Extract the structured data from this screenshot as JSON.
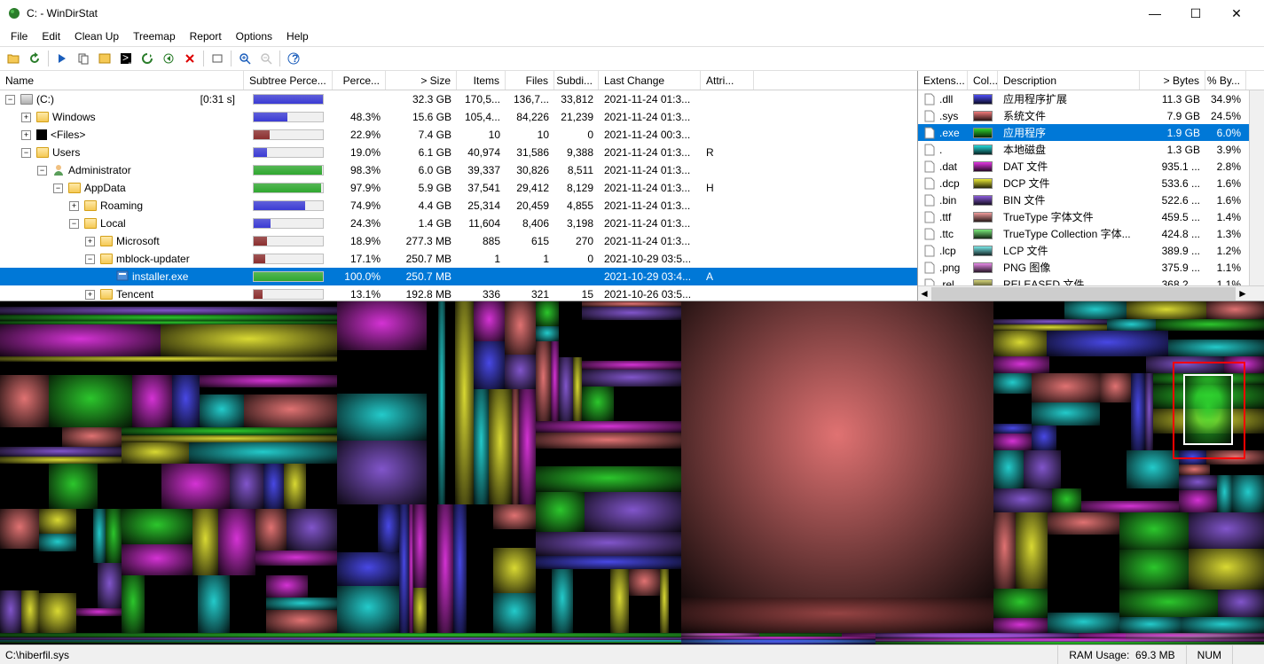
{
  "window": {
    "title": "C: - WinDirStat",
    "controls": {
      "min": "—",
      "max": "☐",
      "close": "✕"
    }
  },
  "menu": [
    "File",
    "Edit",
    "Clean Up",
    "Treemap",
    "Report",
    "Options",
    "Help"
  ],
  "tree": {
    "headers": [
      "Name",
      "Subtree Perce...",
      "Perce...",
      "> Size",
      "Items",
      "Files",
      "Subdi...",
      "Last Change",
      "Attri..."
    ],
    "widths": [
      275,
      100,
      60,
      80,
      55,
      55,
      50,
      115,
      60
    ],
    "rows": [
      {
        "indent": 0,
        "toggle": "-",
        "icon": "drive",
        "name": "(C:)",
        "suffix": "[0:31 s]",
        "bar": 100,
        "barColor": "#3b3bd4",
        "perc": "",
        "size": "32.3 GB",
        "items": "170,5...",
        "files": "136,7...",
        "subdir": "33,812",
        "date": "2021-11-24  01:3...",
        "attr": ""
      },
      {
        "indent": 1,
        "toggle": "+",
        "icon": "folder",
        "name": "Windows",
        "bar": 48.3,
        "barColor": "#3b3bd4",
        "perc": "48.3%",
        "size": "15.6 GB",
        "items": "105,4...",
        "files": "84,226",
        "subdir": "21,239",
        "date": "2021-11-24  01:3...",
        "attr": ""
      },
      {
        "indent": 1,
        "toggle": "+",
        "icon": "files",
        "name": "<Files>",
        "bar": 22.9,
        "barColor": "#8b2e2e",
        "perc": "22.9%",
        "size": "7.4 GB",
        "items": "10",
        "files": "10",
        "subdir": "0",
        "date": "2021-11-24  00:3...",
        "attr": ""
      },
      {
        "indent": 1,
        "toggle": "-",
        "icon": "folder",
        "name": "Users",
        "bar": 19.0,
        "barColor": "#3b3bd4",
        "perc": "19.0%",
        "size": "6.1 GB",
        "items": "40,974",
        "files": "31,586",
        "subdir": "9,388",
        "date": "2021-11-24  01:3...",
        "attr": "R"
      },
      {
        "indent": 2,
        "toggle": "-",
        "icon": "user",
        "name": "Administrator",
        "bar": 98.3,
        "barColor": "#2fa82f",
        "perc": "98.3%",
        "size": "6.0 GB",
        "items": "39,337",
        "files": "30,826",
        "subdir": "8,511",
        "date": "2021-11-24  01:3...",
        "attr": ""
      },
      {
        "indent": 3,
        "toggle": "-",
        "icon": "folder",
        "name": "AppData",
        "bar": 97.9,
        "barColor": "#2fa82f",
        "perc": "97.9%",
        "size": "5.9 GB",
        "items": "37,541",
        "files": "29,412",
        "subdir": "8,129",
        "date": "2021-11-24  01:3...",
        "attr": "H"
      },
      {
        "indent": 4,
        "toggle": "+",
        "icon": "folder",
        "name": "Roaming",
        "bar": 74.9,
        "barColor": "#3b3bd4",
        "perc": "74.9%",
        "size": "4.4 GB",
        "items": "25,314",
        "files": "20,459",
        "subdir": "4,855",
        "date": "2021-11-24  01:3...",
        "attr": ""
      },
      {
        "indent": 4,
        "toggle": "-",
        "icon": "folder",
        "name": "Local",
        "bar": 24.3,
        "barColor": "#3b3bd4",
        "perc": "24.3%",
        "size": "1.4 GB",
        "items": "11,604",
        "files": "8,406",
        "subdir": "3,198",
        "date": "2021-11-24  01:3...",
        "attr": ""
      },
      {
        "indent": 5,
        "toggle": "+",
        "icon": "folder",
        "name": "Microsoft",
        "bar": 18.9,
        "barColor": "#8b2e2e",
        "perc": "18.9%",
        "size": "277.3 MB",
        "items": "885",
        "files": "615",
        "subdir": "270",
        "date": "2021-11-24  01:3...",
        "attr": ""
      },
      {
        "indent": 5,
        "toggle": "-",
        "icon": "folder",
        "name": "mblock-updater",
        "bar": 17.1,
        "barColor": "#8b2e2e",
        "perc": "17.1%",
        "size": "250.7 MB",
        "items": "1",
        "files": "1",
        "subdir": "0",
        "date": "2021-10-29  03:5...",
        "attr": ""
      },
      {
        "indent": 6,
        "toggle": "",
        "icon": "exe",
        "name": "installer.exe",
        "bar": 100,
        "barColor": "#2fa82f",
        "perc": "100.0%",
        "size": "250.7 MB",
        "items": "",
        "files": "",
        "subdir": "",
        "date": "2021-10-29  03:4...",
        "attr": "A",
        "selected": true
      },
      {
        "indent": 5,
        "toggle": "+",
        "icon": "folder",
        "name": "Tencent",
        "bar": 13.1,
        "barColor": "#8b2e2e",
        "perc": "13.1%",
        "size": "192.8 MB",
        "items": "336",
        "files": "321",
        "subdir": "15",
        "date": "2021-10-26  03:5...",
        "attr": ""
      }
    ]
  },
  "ext": {
    "headers": [
      "Extens...",
      "Col...",
      "Description",
      "> Bytes",
      "% By..."
    ],
    "widths": [
      56,
      34,
      160,
      74,
      46
    ],
    "rows": [
      {
        "ext": ".dll",
        "color": "#4d4df5",
        "desc": "应用程序扩展",
        "bytes": "11.3 GB",
        "pct": "34.9%"
      },
      {
        "ext": ".sys",
        "color": "#f07a7a",
        "desc": "系统文件",
        "bytes": "7.9 GB",
        "pct": "24.5%"
      },
      {
        "ext": ".exe",
        "color": "#2fd42f",
        "desc": "应用程序",
        "bytes": "1.9 GB",
        "pct": "6.0%",
        "selected": true
      },
      {
        "ext": ".",
        "color": "#26d9d9",
        "desc": "本地磁盘",
        "bytes": "1.3 GB",
        "pct": "3.9%"
      },
      {
        "ext": ".dat",
        "color": "#e336e3",
        "desc": "DAT 文件",
        "bytes": "935.1 ...",
        "pct": "2.8%"
      },
      {
        "ext": ".dcp",
        "color": "#e8e836",
        "desc": "DCP 文件",
        "bytes": "533.6 ...",
        "pct": "1.6%"
      },
      {
        "ext": ".bin",
        "color": "#8a5bd9",
        "desc": "BIN 文件",
        "bytes": "522.6 ...",
        "pct": "1.6%"
      },
      {
        "ext": ".ttf",
        "color": "#f09c9c",
        "desc": "TrueType 字体文件",
        "bytes": "459.5 ...",
        "pct": "1.4%"
      },
      {
        "ext": ".ttc",
        "color": "#7ae87a",
        "desc": "TrueType Collection 字体...",
        "bytes": "424.8 ...",
        "pct": "1.3%"
      },
      {
        "ext": ".lcp",
        "color": "#7ae8e8",
        "desc": "LCP 文件",
        "bytes": "389.9 ...",
        "pct": "1.2%"
      },
      {
        "ext": ".png",
        "color": "#e88ae8",
        "desc": "PNG 图像",
        "bytes": "375.9 ...",
        "pct": "1.1%"
      },
      {
        "ext": ".rel",
        "color": "#d4d478",
        "desc": "RELEASED 文件",
        "bytes": "368.2 ...",
        "pct": "1.1%"
      }
    ]
  },
  "statusbar": {
    "path": "C:\\hiberfil.sys",
    "ram_label": "RAM Usage:",
    "ram": "69.3 MB",
    "num": "NUM"
  }
}
